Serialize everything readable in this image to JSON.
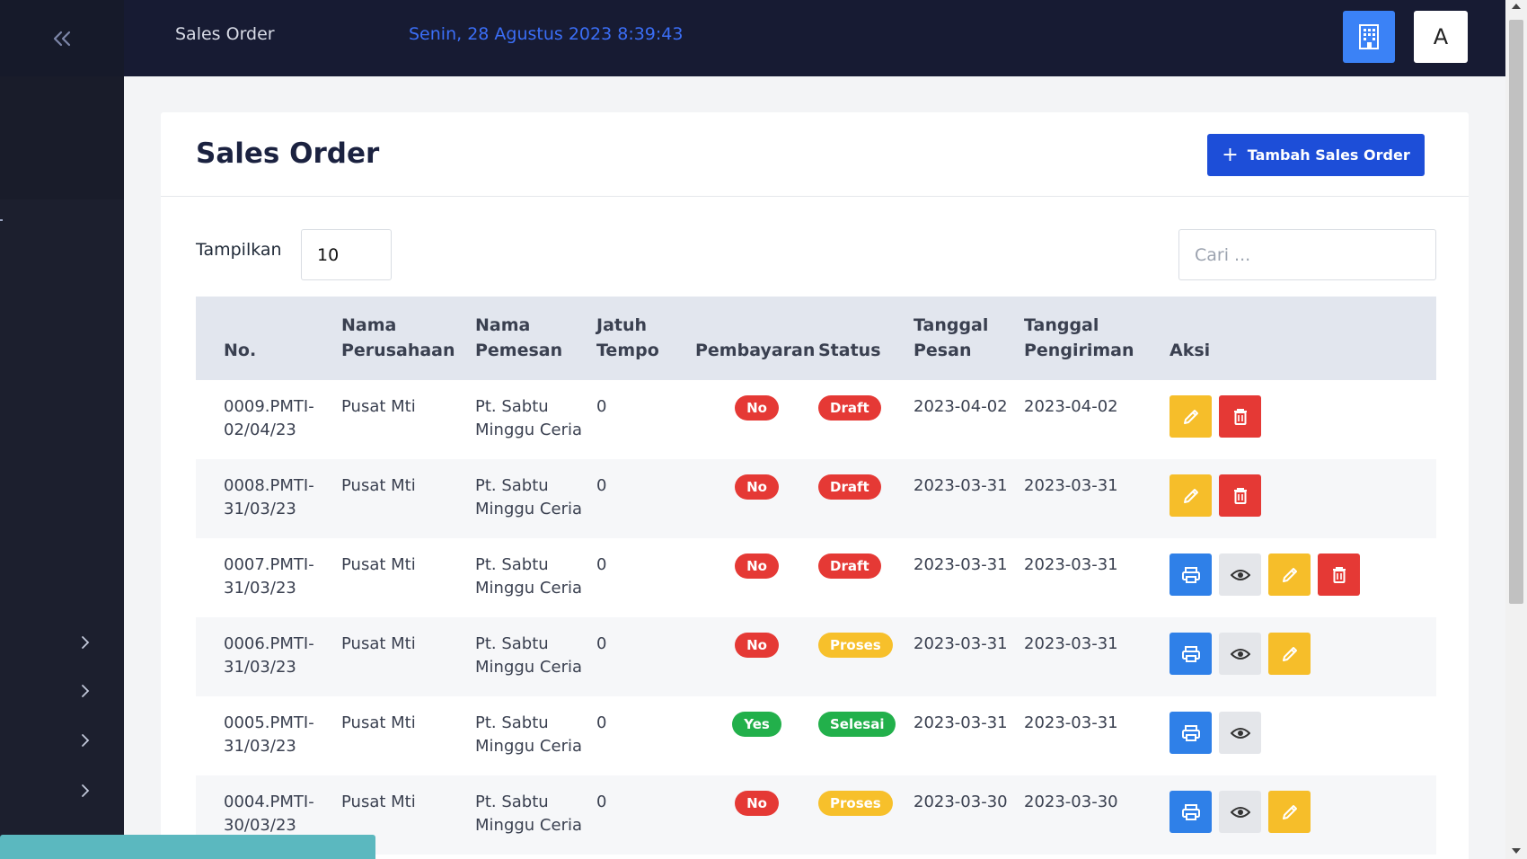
{
  "topbar": {
    "title": "Sales Order",
    "datetime": "Senin, 28 Agustus 2023 8:39:43",
    "avatar_letter": "A"
  },
  "page": {
    "title": "Sales Order",
    "add_button_label": "Tambah Sales Order"
  },
  "controls": {
    "show_label": "Tampilkan",
    "show_value": "10",
    "search_placeholder": "Cari ..."
  },
  "table": {
    "headers": [
      "No.",
      "Nama Perusahaan",
      "Nama Pemesan",
      "Jatuh Tempo",
      "Pembayaran",
      "Status",
      "Tanggal Pesan",
      "Tanggal Pengiriman",
      "Aksi"
    ],
    "rows": [
      {
        "no": "0009.PMTI-02/04/23",
        "perusahaan": "Pusat Mti",
        "pemesan": "Pt. Sabtu Minggu Ceria",
        "jatuh_tempo": "0",
        "pembayaran": "No",
        "status": "Draft",
        "tgl_pesan": "2023-04-02",
        "tgl_kirim": "2023-04-02",
        "actions": [
          "edit",
          "delete"
        ]
      },
      {
        "no": "0008.PMTI-31/03/23",
        "perusahaan": "Pusat Mti",
        "pemesan": "Pt. Sabtu Minggu Ceria",
        "jatuh_tempo": "0",
        "pembayaran": "No",
        "status": "Draft",
        "tgl_pesan": "2023-03-31",
        "tgl_kirim": "2023-03-31",
        "actions": [
          "edit",
          "delete"
        ]
      },
      {
        "no": "0007.PMTI-31/03/23",
        "perusahaan": "Pusat Mti",
        "pemesan": "Pt. Sabtu Minggu Ceria",
        "jatuh_tempo": "0",
        "pembayaran": "No",
        "status": "Draft",
        "tgl_pesan": "2023-03-31",
        "tgl_kirim": "2023-03-31",
        "actions": [
          "print",
          "view",
          "edit",
          "delete"
        ]
      },
      {
        "no": "0006.PMTI-31/03/23",
        "perusahaan": "Pusat Mti",
        "pemesan": "Pt. Sabtu Minggu Ceria",
        "jatuh_tempo": "0",
        "pembayaran": "No",
        "status": "Proses",
        "tgl_pesan": "2023-03-31",
        "tgl_kirim": "2023-03-31",
        "actions": [
          "print",
          "view",
          "edit"
        ]
      },
      {
        "no": "0005.PMTI-31/03/23",
        "perusahaan": "Pusat Mti",
        "pemesan": "Pt. Sabtu Minggu Ceria",
        "jatuh_tempo": "0",
        "pembayaran": "Yes",
        "status": "Selesai",
        "tgl_pesan": "2023-03-31",
        "tgl_kirim": "2023-03-31",
        "actions": [
          "print",
          "view"
        ]
      },
      {
        "no": "0004.PMTI-30/03/23",
        "perusahaan": "Pusat Mti",
        "pemesan": "Pt. Sabtu Minggu Ceria",
        "jatuh_tempo": "0",
        "pembayaran": "No",
        "status": "Proses",
        "tgl_pesan": "2023-03-30",
        "tgl_kirim": "2023-03-30",
        "actions": [
          "print",
          "view",
          "edit"
        ]
      }
    ]
  },
  "colors": {
    "sidebar": "#1c1f2e",
    "topbar": "#171b33",
    "primary": "#1d4ed8",
    "badge_no": "#e53935",
    "badge_yes": "#22b04b",
    "badge_draft": "#e53935",
    "badge_proses": "#f7c02b",
    "badge_selesai": "#22b04b"
  },
  "icons": {
    "collapse": "double-chevron-left-icon",
    "building": "building-icon",
    "add": "plus-icon",
    "print": "printer-icon",
    "view": "eye-icon",
    "edit": "pencil-icon",
    "delete": "trash-icon",
    "expand": "chevron-right-icon"
  }
}
